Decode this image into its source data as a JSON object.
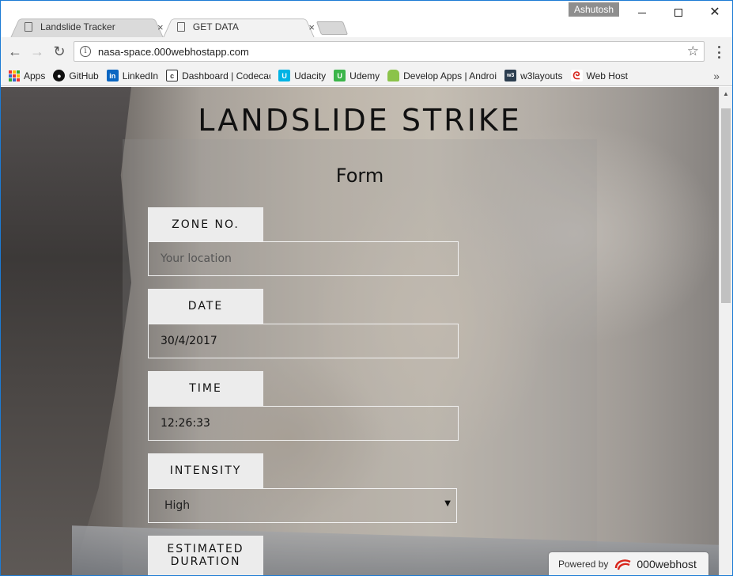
{
  "window": {
    "user": "Ashutosh"
  },
  "tabs": [
    {
      "title": "Landslide Tracker",
      "close": "×"
    },
    {
      "title": "GET DATA",
      "close": "×"
    }
  ],
  "toolbar": {
    "url": "nasa-space.000webhostapp.com"
  },
  "bookmarks": {
    "items": [
      {
        "label": "Apps"
      },
      {
        "label": "GitHub"
      },
      {
        "label": "LinkedIn"
      },
      {
        "label": "Dashboard | Codecademy"
      },
      {
        "label": "Udacity"
      },
      {
        "label": "Udemy"
      },
      {
        "label": "Develop Apps | Android"
      },
      {
        "label": "w3layouts"
      },
      {
        "label": "Web Host"
      }
    ],
    "overflow": "»"
  },
  "page": {
    "title": "LANDSLIDE STRIKE",
    "form_title": "Form",
    "fields": {
      "zone": {
        "label": "ZONE NO.",
        "placeholder": "Your location"
      },
      "date": {
        "label": "DATE",
        "value": "30/4/2017"
      },
      "time": {
        "label": "TIME",
        "value": "12:26:33"
      },
      "intensity": {
        "label": "INTENSITY",
        "selected": "High"
      },
      "duration": {
        "label": "ESTIMATED DURATION"
      }
    }
  },
  "footer": {
    "powered_by": "Powered by",
    "brand": "000webhost"
  },
  "colors": {
    "brand_red": "#d8261c",
    "titlebar_border": "#1c7bd4"
  }
}
